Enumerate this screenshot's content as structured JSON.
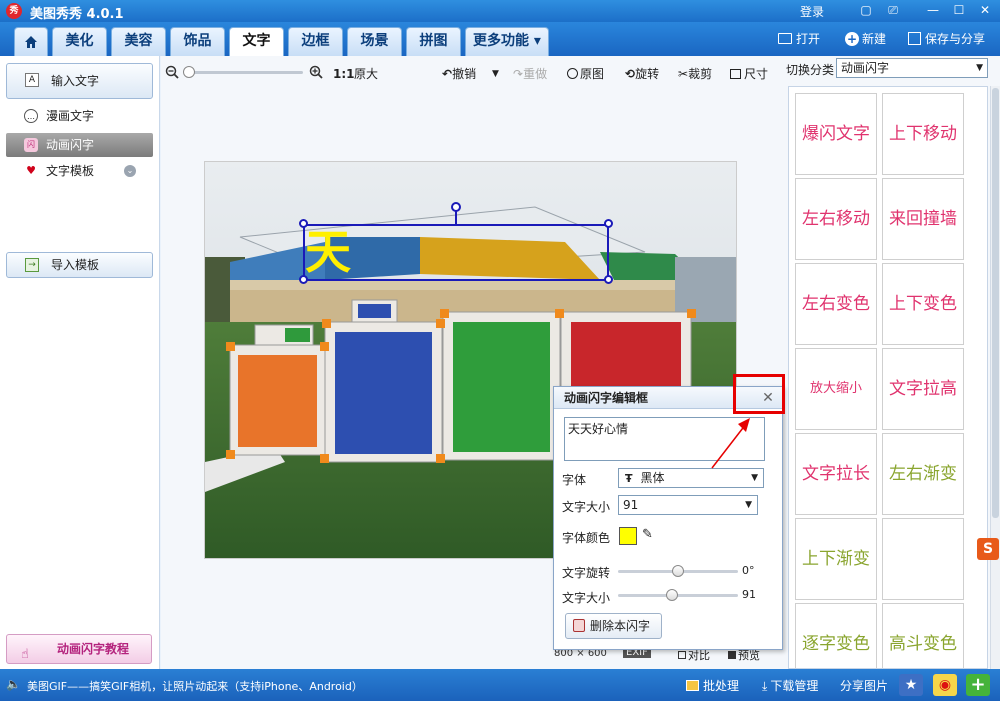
{
  "app": {
    "logo_text": "秀",
    "title": "美图秀秀 4.0.1",
    "login": "登录"
  },
  "window_controls": {
    "chat": "▢",
    "skin": "⎚",
    "minimize": "—",
    "maximize": "☐",
    "close": "✕"
  },
  "tabs": [
    {
      "label": "美化"
    },
    {
      "label": "美容"
    },
    {
      "label": "饰品"
    },
    {
      "label": "文字"
    },
    {
      "label": "边框"
    },
    {
      "label": "场景"
    },
    {
      "label": "拼图"
    },
    {
      "label": "更多功能 ▾"
    }
  ],
  "top_actions": {
    "open": "打开",
    "new": "新建",
    "save": "保存与分享"
  },
  "left": {
    "input_text": "输入文字",
    "items": [
      {
        "label": "漫画文字",
        "icon": "💬"
      },
      {
        "label": "动画闪字",
        "icon": "闪"
      },
      {
        "label": "文字模板",
        "icon": "♥"
      }
    ],
    "import_template": "导入模板",
    "tutorial": "动画闪字教程"
  },
  "toolbar": {
    "ratio": "1:1",
    "original_size": "原大",
    "undo": "撤销",
    "redo": "重做",
    "original": "原图",
    "rotate": "旋转",
    "crop": "裁剪",
    "size": "尺寸",
    "zoom_level": 0.05
  },
  "canvas": {
    "overlay_char": "天",
    "image_size": "800 × 600",
    "exif": "EXIF",
    "compare": "对比",
    "preview": "预览"
  },
  "right": {
    "switch_label": "切换分类",
    "switch_value": "动画闪字",
    "tiles": [
      {
        "label": "爆闪文字",
        "color": "#e0336e"
      },
      {
        "label": "上下移动",
        "color": "#e0336e"
      },
      {
        "label": "左右移动",
        "color": "#e0336e"
      },
      {
        "label": "来回撞墙",
        "color": "#e0336e"
      },
      {
        "label": "左右变色",
        "color": "#e0336e"
      },
      {
        "label": "上下变色",
        "color": "#e0336e"
      },
      {
        "label": "放大缩小",
        "color": "#e0336e"
      },
      {
        "label": "文字拉高",
        "color": "#e0336e"
      },
      {
        "label": "文字拉长",
        "color": "#e0336e"
      },
      {
        "label": "左右渐变",
        "color": "#8aa52f"
      },
      {
        "label": "上下渐变",
        "color": "#8aa52f"
      },
      {
        "label": "",
        "color": "#8aa52f"
      },
      {
        "label": "逐字变色",
        "color": "#8aa52f"
      },
      {
        "label": "高斗变色",
        "color": "#8aa52f"
      }
    ]
  },
  "dialog": {
    "title": "动画闪字编辑框",
    "text": "天天好心情",
    "font_label": "字体",
    "font_value": "黑体",
    "size_label": "文字大小",
    "size_value": "91",
    "color_label": "字体颜色",
    "color_hex": "#ffff00",
    "rotate_label": "文字旋转",
    "rotate_value": "0°",
    "rotate_fraction": 0.5,
    "size2_label": "文字大小",
    "size2_value": "91",
    "size2_fraction": 0.45,
    "delete_btn": "删除本闪字"
  },
  "status": {
    "message": "美图GIF——搞笑GIF相机，让照片动起来（支持iPhone、Android）",
    "batch": "批处理",
    "download": "下载管理",
    "share": "分享图片"
  },
  "colors": {
    "accent": "#1c6fc8",
    "annotation_red": "#e60000"
  }
}
